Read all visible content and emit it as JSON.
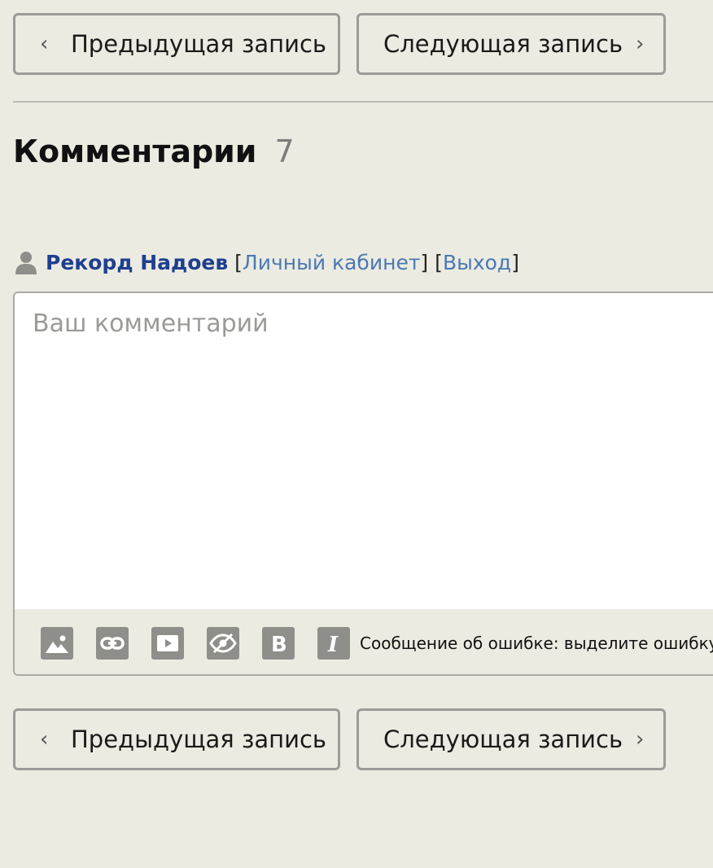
{
  "navigation": {
    "prev_label": "Предыдущая запись",
    "next_label": "Следующая запись"
  },
  "comments": {
    "title": "Комментарии",
    "count": "7"
  },
  "user": {
    "name": "Рекорд Надоев",
    "bracket_open": "[",
    "bracket_close": "]",
    "cabinet_link": "Личный кабинет",
    "logout_link": "Выход"
  },
  "form": {
    "placeholder": "Ваш комментарий",
    "error_hint": "Сообщение об ошибке: выделите ошибку"
  },
  "toolbar": {
    "icons": [
      "image-icon",
      "link-icon",
      "video-icon",
      "hidden-icon",
      "bold-icon",
      "italic-icon"
    ]
  },
  "colors": {
    "background": "#ecebe1",
    "user_name": "#1e3f8f",
    "link": "#4a78b4",
    "tool_icon": "#8e8e8b"
  }
}
